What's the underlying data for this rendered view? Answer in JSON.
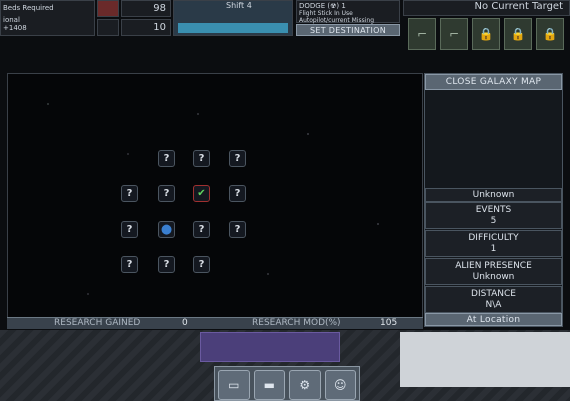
{
  "hud": {
    "crew_note_1": "Beds Required",
    "crew_note_2": "ional",
    "crew_note_3": "+1408",
    "stat_top": "98",
    "stat_bottom": "10",
    "shift_label": "Shift 4",
    "dodge_label": "DODGE (☢) 1",
    "dodge_sub_1": "Flight Stick In Use",
    "dodge_sub_2": "Autopilot/current Missing",
    "set_destination": "SET DESTINATION",
    "target_label": "No Current Target"
  },
  "map": {
    "close_button": "CLOSE GALAXY MAP",
    "nodes": [
      {
        "label": "?"
      },
      {
        "label": "?"
      },
      {
        "label": "?"
      },
      {
        "label": "?"
      },
      {
        "label": "?"
      },
      {
        "label": "✔"
      },
      {
        "label": "?"
      },
      {
        "label": "?"
      },
      {
        "label": "●"
      },
      {
        "label": "?"
      },
      {
        "label": "?"
      },
      {
        "label": "?"
      },
      {
        "label": "?"
      },
      {
        "label": "?"
      }
    ]
  },
  "info": {
    "name": "Unknown",
    "events_label": "EVENTS",
    "events_value": "5",
    "difficulty_label": "DIFFICULTY",
    "difficulty_value": "1",
    "alien_label": "ALIEN PRESENCE",
    "alien_value": "Unknown",
    "distance_label": "DISTANCE",
    "distance_value": "N\\A",
    "at_location": "At Location"
  },
  "research": {
    "gained_label": "RESEARCH GAINED",
    "gained_value": "0",
    "mod_label": "RESEARCH MOD(%)",
    "mod_value": "105"
  },
  "colors": {
    "accent": "#8a98a6",
    "check": "#5fd35f",
    "planet": "#3a7fd0"
  }
}
